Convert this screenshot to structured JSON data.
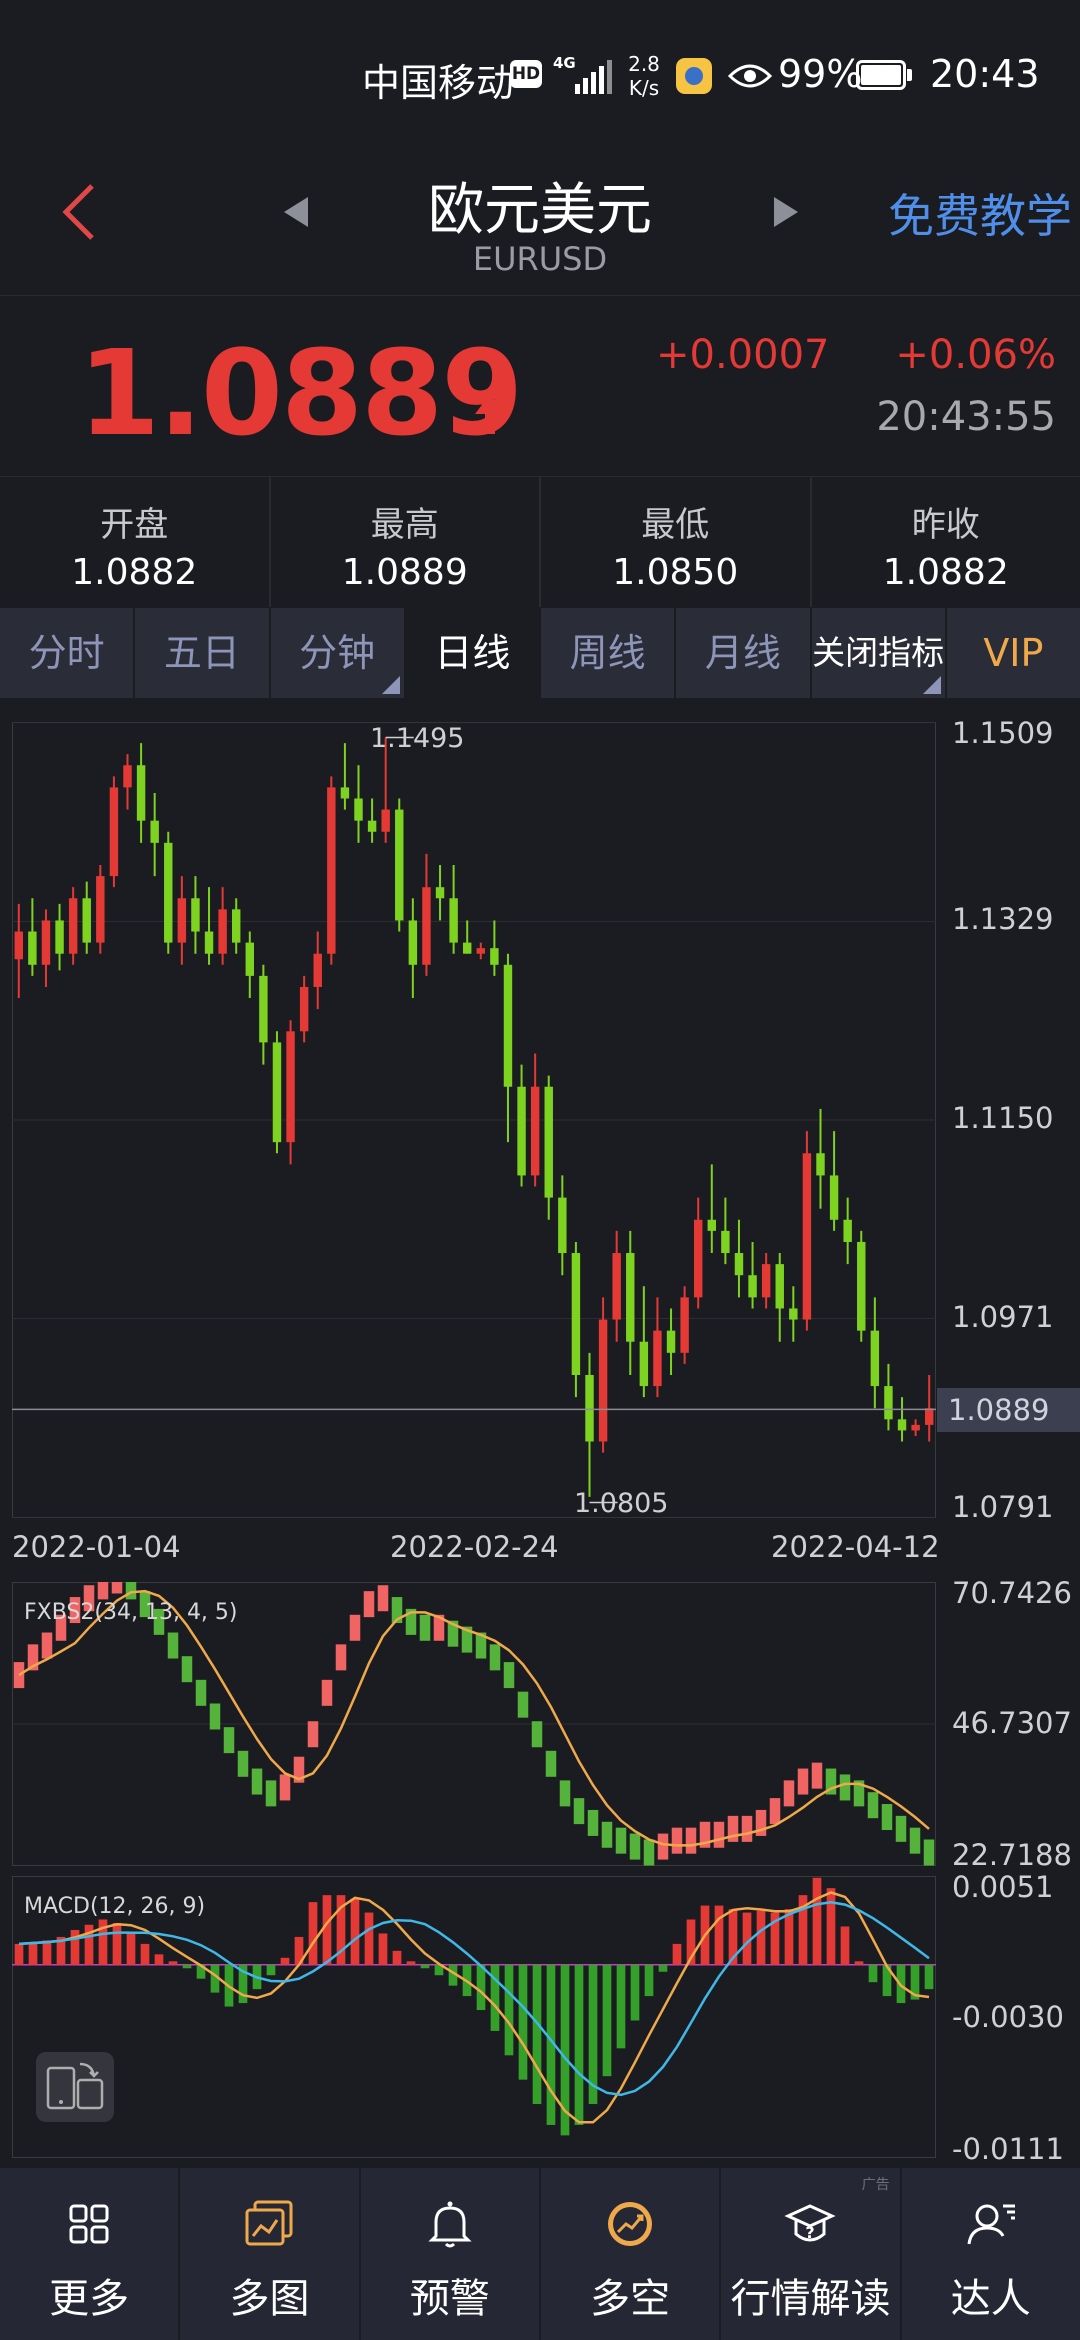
{
  "status_bar": {
    "carrier": "中国移动",
    "hd": "HD",
    "network": "4G",
    "speed_value": "2.8",
    "speed_unit": "K/s",
    "battery": "99%",
    "time": "20:43"
  },
  "header": {
    "title": "欧元美元",
    "subtitle": "EURUSD",
    "free_teach": "免费教学"
  },
  "quote": {
    "price": "1.0889",
    "change": "+0.0007",
    "change_pct": "+0.06%",
    "time": "20:43:55"
  },
  "stats": [
    {
      "label": "开盘",
      "value": "1.0882"
    },
    {
      "label": "最高",
      "value": "1.0889"
    },
    {
      "label": "最低",
      "value": "1.0850"
    },
    {
      "label": "昨收",
      "value": "1.0882"
    }
  ],
  "tabs": [
    "分时",
    "五日",
    "分钟",
    "日线",
    "周线",
    "月线",
    "关闭指标",
    "VIP"
  ],
  "active_tab": "日线",
  "main_chart": {
    "y_ticks": [
      "1.1509",
      "1.1329",
      "1.1150",
      "1.0971",
      "1.0791"
    ],
    "current_price_label": "1.0889",
    "high_marker": "1.1495",
    "low_marker": "1.0805",
    "x_labels": [
      "2022-01-04",
      "2022-02-24",
      "2022-04-12"
    ]
  },
  "fxbs_chart": {
    "label": "FXBS2(34, 13, 4, 5)",
    "y_ticks": [
      "70.7426",
      "46.7307",
      "22.7188"
    ]
  },
  "macd_chart": {
    "label": "MACD(12, 26, 9)",
    "y_ticks": [
      "0.0051",
      "-0.0030",
      "-0.0111"
    ]
  },
  "bottom_nav": [
    {
      "label": "更多",
      "icon": "grid-icon"
    },
    {
      "label": "多图",
      "icon": "multi-chart-icon"
    },
    {
      "label": "预警",
      "icon": "bell-icon"
    },
    {
      "label": "多空",
      "icon": "long-short-icon"
    },
    {
      "label": "行情解读",
      "icon": "graduation-cap-icon"
    },
    {
      "label": "达人",
      "icon": "expert-user-icon"
    }
  ],
  "ad_tag": "广告",
  "colors": {
    "up": "#e53935",
    "down": "#7ed321",
    "accent": "#4f8ee9",
    "vip": "#f0a94a",
    "background": "#1b1c21"
  },
  "chart_data": [
    {
      "type": "candlestick",
      "title": "",
      "x_range": [
        "2022-01-04",
        "2022-04-12"
      ],
      "ylim": [
        1.0791,
        1.1509
      ],
      "annotations": {
        "high": 1.1495,
        "low": 1.0805,
        "last": 1.0889
      },
      "candles": [
        [
          1.1295,
          1.1345,
          1.126,
          1.132
        ],
        [
          1.132,
          1.135,
          1.128,
          1.129
        ],
        [
          1.129,
          1.134,
          1.127,
          1.133
        ],
        [
          1.133,
          1.1345,
          1.1285,
          1.13
        ],
        [
          1.13,
          1.136,
          1.129,
          1.135
        ],
        [
          1.135,
          1.1365,
          1.13,
          1.131
        ],
        [
          1.131,
          1.138,
          1.13,
          1.137
        ],
        [
          1.137,
          1.146,
          1.136,
          1.145
        ],
        [
          1.145,
          1.148,
          1.143,
          1.147
        ],
        [
          1.147,
          1.149,
          1.14,
          1.142
        ],
        [
          1.142,
          1.1445,
          1.137,
          1.14
        ],
        [
          1.14,
          1.141,
          1.13,
          1.131
        ],
        [
          1.131,
          1.137,
          1.129,
          1.135
        ],
        [
          1.135,
          1.137,
          1.13,
          1.132
        ],
        [
          1.132,
          1.136,
          1.129,
          1.13
        ],
        [
          1.13,
          1.136,
          1.129,
          1.134
        ],
        [
          1.134,
          1.135,
          1.13,
          1.131
        ],
        [
          1.131,
          1.132,
          1.126,
          1.128
        ],
        [
          1.128,
          1.129,
          1.12,
          1.122
        ],
        [
          1.122,
          1.123,
          1.112,
          1.113
        ],
        [
          1.113,
          1.124,
          1.111,
          1.123
        ],
        [
          1.123,
          1.128,
          1.122,
          1.127
        ],
        [
          1.127,
          1.132,
          1.125,
          1.13
        ],
        [
          1.13,
          1.146,
          1.129,
          1.145
        ],
        [
          1.145,
          1.149,
          1.143,
          1.144
        ],
        [
          1.144,
          1.147,
          1.14,
          1.142
        ],
        [
          1.142,
          1.144,
          1.14,
          1.141
        ],
        [
          1.141,
          1.1495,
          1.14,
          1.143
        ],
        [
          1.143,
          1.144,
          1.132,
          1.133
        ],
        [
          1.133,
          1.135,
          1.126,
          1.129
        ],
        [
          1.129,
          1.139,
          1.128,
          1.136
        ],
        [
          1.136,
          1.138,
          1.133,
          1.135
        ],
        [
          1.135,
          1.138,
          1.13,
          1.131
        ],
        [
          1.131,
          1.133,
          1.13,
          1.13
        ],
        [
          1.13,
          1.131,
          1.1295,
          1.1305
        ],
        [
          1.1305,
          1.133,
          1.128,
          1.129
        ],
        [
          1.129,
          1.13,
          1.113,
          1.118
        ],
        [
          1.118,
          1.12,
          1.109,
          1.11
        ],
        [
          1.11,
          1.121,
          1.109,
          1.118
        ],
        [
          1.118,
          1.119,
          1.106,
          1.108
        ],
        [
          1.108,
          1.11,
          1.101,
          1.103
        ],
        [
          1.103,
          1.104,
          1.09,
          1.092
        ],
        [
          1.092,
          1.094,
          1.081,
          1.086
        ],
        [
          1.086,
          1.099,
          1.085,
          1.097
        ],
        [
          1.097,
          1.105,
          1.095,
          1.103
        ],
        [
          1.103,
          1.105,
          1.092,
          1.095
        ],
        [
          1.095,
          1.1,
          1.09,
          1.091
        ],
        [
          1.091,
          1.099,
          1.09,
          1.096
        ],
        [
          1.096,
          1.098,
          1.092,
          1.094
        ],
        [
          1.094,
          1.1,
          1.093,
          1.099
        ],
        [
          1.099,
          1.108,
          1.098,
          1.106
        ],
        [
          1.106,
          1.111,
          1.103,
          1.105
        ],
        [
          1.105,
          1.108,
          1.102,
          1.103
        ],
        [
          1.103,
          1.106,
          1.099,
          1.101
        ],
        [
          1.101,
          1.104,
          1.098,
          1.099
        ],
        [
          1.099,
          1.103,
          1.098,
          1.102
        ],
        [
          1.102,
          1.103,
          1.095,
          1.098
        ],
        [
          1.098,
          1.1,
          1.095,
          1.097
        ],
        [
          1.097,
          1.114,
          1.096,
          1.112
        ],
        [
          1.112,
          1.116,
          1.107,
          1.11
        ],
        [
          1.11,
          1.114,
          1.105,
          1.106
        ],
        [
          1.106,
          1.108,
          1.102,
          1.104
        ],
        [
          1.104,
          1.105,
          1.095,
          1.096
        ],
        [
          1.096,
          1.099,
          1.089,
          1.091
        ],
        [
          1.091,
          1.093,
          1.087,
          1.088
        ],
        [
          1.088,
          1.09,
          1.086,
          1.087
        ],
        [
          1.087,
          1.088,
          1.0865,
          1.0875
        ],
        [
          1.0875,
          1.092,
          1.086,
          1.089
        ]
      ]
    },
    {
      "type": "bar",
      "title": "FXBS2(34, 13, 4, 5)",
      "ylim": [
        22.7188,
        70.7426
      ],
      "series": [
        {
          "name": "FXBS2",
          "values": [
            55,
            58,
            60,
            63,
            66,
            68,
            70,
            71,
            70,
            67,
            64,
            60,
            56,
            52,
            48,
            44,
            40,
            37,
            35,
            36,
            39,
            45,
            52,
            58,
            63,
            67,
            68,
            66,
            64,
            63,
            63,
            62,
            61,
            60,
            58,
            55,
            50,
            45,
            40,
            35,
            32,
            30,
            28,
            27,
            26,
            25,
            26,
            27,
            27,
            28,
            28,
            29,
            29,
            30,
            32,
            35,
            37,
            38,
            37,
            36,
            35,
            33,
            31,
            29,
            27,
            25
          ]
        }
      ]
    },
    {
      "type": "bar",
      "title": "MACD(12, 26, 9)",
      "ylim": [
        -0.0111,
        0.0051
      ],
      "series": [
        {
          "name": "MACD",
          "values": [
            0.0012,
            0.0013,
            0.0014,
            0.0016,
            0.002,
            0.0023,
            0.0026,
            0.0024,
            0.0018,
            0.0012,
            0.0006,
            0.0002,
            -0.0002,
            -0.0008,
            -0.0016,
            -0.0024,
            -0.0022,
            -0.0014,
            -0.0006,
            0.0004,
            0.0016,
            0.0036,
            0.004,
            0.004,
            0.0038,
            0.003,
            0.0018,
            0.0008,
            0.0002,
            -0.0002,
            -0.0006,
            -0.0012,
            -0.0018,
            -0.0026,
            -0.0038,
            -0.0052,
            -0.0066,
            -0.008,
            -0.0092,
            -0.0098,
            -0.0092,
            -0.008,
            -0.0064,
            -0.0048,
            -0.0032,
            -0.0018,
            -0.0004,
            0.0012,
            0.0026,
            0.0034,
            0.0034,
            0.0032,
            0.003,
            0.0031,
            0.003,
            0.0032,
            0.004,
            0.005,
            0.0044,
            0.0022,
            0.0002,
            -0.001,
            -0.0018,
            -0.0022,
            -0.002,
            -0.0014
          ]
        }
      ]
    }
  ]
}
